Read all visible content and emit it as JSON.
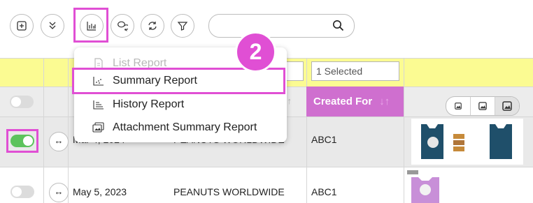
{
  "toolbar": {
    "buttons": [
      "add-row",
      "collapse-all",
      "report",
      "chat",
      "refresh",
      "filter"
    ],
    "search": {
      "placeholder": "",
      "value": ""
    }
  },
  "filters": {
    "selected_count": "1 Selected"
  },
  "headers": {
    "created_for": "Created For",
    "sort_glyph": "↓↑"
  },
  "rows": [
    {
      "date": "Mar 4, 2024",
      "company": "PEANUTS WORLDWIDE",
      "created_for": "ABC1",
      "enabled": true
    },
    {
      "date": "May 5, 2023",
      "company": "PEANUTS WORLDWIDE",
      "created_for": "ABC1",
      "enabled": false
    }
  ],
  "report_menu": {
    "items": [
      {
        "label": "List Report",
        "icon": "list-report-icon",
        "disabled": true
      },
      {
        "label": "Summary Report",
        "icon": "summary-report-icon",
        "disabled": false
      },
      {
        "label": "History Report",
        "icon": "history-report-icon",
        "disabled": false
      },
      {
        "label": "Attachment Summary Report",
        "icon": "attachment-summary-icon",
        "disabled": false
      }
    ]
  },
  "callout": {
    "step": "2"
  },
  "colors": {
    "highlight": "#e04fd4",
    "filter_band": "#fbfb92",
    "created_for_header": "#cf6fcf",
    "toggle_on": "#5cc35c"
  }
}
